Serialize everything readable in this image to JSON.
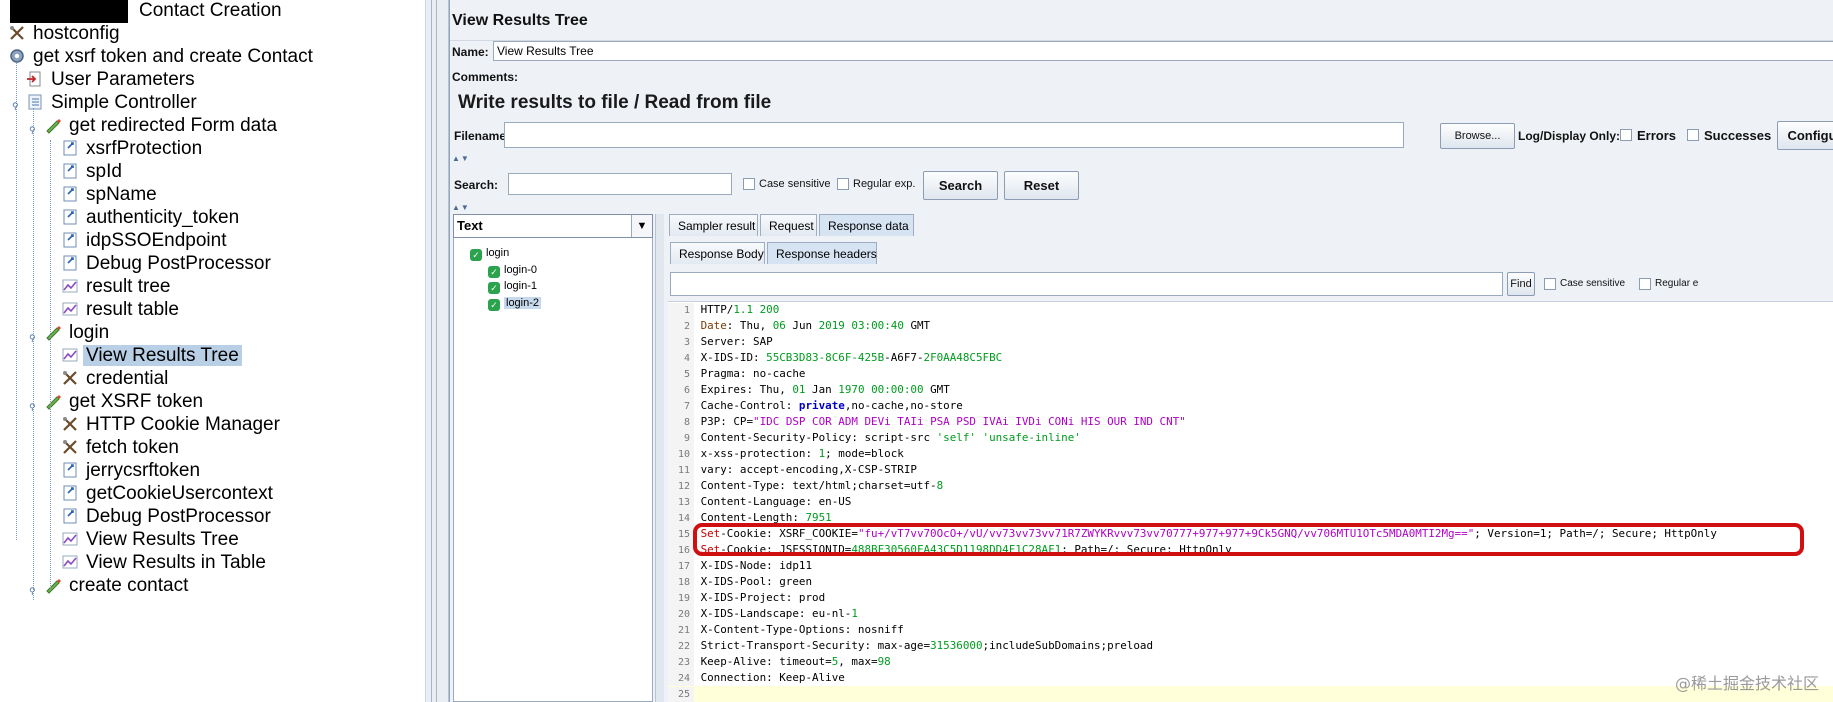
{
  "tree": {
    "items": [
      {
        "label": "Contact Creation",
        "icon": "test-plan-icon",
        "level": 0,
        "redacted_prefix": true
      },
      {
        "label": "hostconfig",
        "icon": "config-element-icon",
        "level": 0
      },
      {
        "label": "get xsrf token and create Contact",
        "icon": "thread-group-gear-icon",
        "level": 0
      },
      {
        "label": "User Parameters",
        "icon": "preprocessor-icon",
        "level": 1
      },
      {
        "label": "Simple Controller",
        "icon": "controller-icon",
        "level": 1
      },
      {
        "label": "get redirected Form data",
        "icon": "sampler-pencil-icon",
        "level": 2
      },
      {
        "label": "xsrfProtection",
        "icon": "extractor-icon",
        "level": 3
      },
      {
        "label": "spId",
        "icon": "extractor-icon",
        "level": 3
      },
      {
        "label": "spName",
        "icon": "extractor-icon",
        "level": 3
      },
      {
        "label": "authenticity_token",
        "icon": "extractor-icon",
        "level": 3
      },
      {
        "label": "idpSSOEndpoint",
        "icon": "extractor-icon",
        "level": 3
      },
      {
        "label": "Debug PostProcessor",
        "icon": "extractor-icon",
        "level": 3
      },
      {
        "label": "result tree",
        "icon": "listener-chart-icon",
        "level": 3
      },
      {
        "label": "result table",
        "icon": "listener-chart-icon",
        "level": 3
      },
      {
        "label": "login",
        "icon": "sampler-pencil-icon",
        "level": 2
      },
      {
        "label": "View Results Tree",
        "icon": "listener-chart-icon",
        "level": 3,
        "selected": true
      },
      {
        "label": "credential",
        "icon": "config-element-icon",
        "level": 3
      },
      {
        "label": "get XSRF token",
        "icon": "sampler-pencil-icon",
        "level": 2
      },
      {
        "label": "HTTP Cookie Manager",
        "icon": "config-element-icon",
        "level": 3
      },
      {
        "label": "fetch token",
        "icon": "config-element-icon",
        "level": 3
      },
      {
        "label": "jerrycsrftoken",
        "icon": "extractor-icon",
        "level": 3
      },
      {
        "label": "getCookieUsercontext",
        "icon": "extractor-icon",
        "level": 3
      },
      {
        "label": "Debug PostProcessor",
        "icon": "extractor-icon",
        "level": 3
      },
      {
        "label": "View Results Tree",
        "icon": "listener-chart-icon",
        "level": 3
      },
      {
        "label": "View Results in Table",
        "icon": "listener-chart-icon",
        "level": 3
      },
      {
        "label": "create contact",
        "icon": "sampler-pencil-icon",
        "level": 2
      }
    ]
  },
  "panel": {
    "title": "View Results Tree",
    "name_label": "Name:",
    "name_value": "View Results Tree",
    "comments_label": "Comments:",
    "section_title": "Write results to file / Read from file",
    "filename_label": "Filename",
    "filename_value": "",
    "browse_label": "Browse...",
    "log_display_label": "Log/Display Only:",
    "errors_label": "Errors",
    "successes_label": "Successes",
    "configure_label": "Configu",
    "search_label": "Search:",
    "search_value": "",
    "case_sensitive_label": "Case sensitive",
    "regex_label": "Regular exp.",
    "search_button": "Search",
    "reset_button": "Reset"
  },
  "results": {
    "renderer": "Text",
    "nodes": [
      {
        "label": "login",
        "level": 0
      },
      {
        "label": "login-0",
        "level": 1
      },
      {
        "label": "login-1",
        "level": 1
      },
      {
        "label": "login-2",
        "level": 1,
        "selected": true
      }
    ],
    "tabs": [
      "Sampler result",
      "Request",
      "Response data"
    ],
    "active_tab": "Response data",
    "subtabs": [
      "Response Body",
      "Response headers"
    ],
    "active_subtab": "Response headers",
    "find_button": "Find",
    "find_case_sensitive": "Case sensitive",
    "find_regex": "Regular e",
    "find_value": ""
  },
  "headers": [
    {
      "n": "1",
      "parts": [
        [
          "cd",
          "HTTP/"
        ],
        [
          "n",
          "1.1"
        ],
        [
          "cd",
          " "
        ],
        [
          "n",
          "200"
        ]
      ]
    },
    {
      "n": "2",
      "parts": [
        [
          "k",
          "Date"
        ],
        [
          "cd",
          ": Thu, "
        ],
        [
          "n",
          "06"
        ],
        [
          "cd",
          " Jun "
        ],
        [
          "n",
          "2019"
        ],
        [
          "cd",
          " "
        ],
        [
          "n",
          "03:00:40"
        ],
        [
          "cd",
          " GMT"
        ]
      ]
    },
    {
      "n": "3",
      "parts": [
        [
          "cd",
          "Server: SAP"
        ]
      ]
    },
    {
      "n": "4",
      "parts": [
        [
          "cd",
          "X-IDS-ID: "
        ],
        [
          "n",
          "55CB3D83-8C6F-425B"
        ],
        [
          "cd",
          "-A6F7-"
        ],
        [
          "n",
          "2F0AA48C5FBC"
        ]
      ]
    },
    {
      "n": "5",
      "parts": [
        [
          "cd",
          "Pragma: no-cache"
        ]
      ]
    },
    {
      "n": "6",
      "parts": [
        [
          "cd",
          "Expires: Thu, "
        ],
        [
          "n",
          "01"
        ],
        [
          "cd",
          " Jan "
        ],
        [
          "n",
          "1970"
        ],
        [
          "cd",
          " "
        ],
        [
          "n",
          "00:00:00"
        ],
        [
          "cd",
          " GMT"
        ]
      ]
    },
    {
      "n": "7",
      "parts": [
        [
          "cd",
          "Cache-Control: "
        ],
        [
          "kw",
          "private"
        ],
        [
          "cd",
          ",no-cache,no-store"
        ]
      ]
    },
    {
      "n": "8",
      "parts": [
        [
          "cd",
          "P3P: CP="
        ],
        [
          "s",
          "\"IDC DSP COR ADM DEVi TAIi PSA PSD IVAi IVDi CONi HIS OUR IND CNT\""
        ]
      ]
    },
    {
      "n": "9",
      "parts": [
        [
          "cd",
          "Content-Security-Policy: script-src "
        ],
        [
          "n",
          "'self' 'unsafe-inline'"
        ]
      ]
    },
    {
      "n": "10",
      "parts": [
        [
          "cd",
          "x-xss-protection: "
        ],
        [
          "n",
          "1"
        ],
        [
          "cd",
          "; mode=block"
        ]
      ]
    },
    {
      "n": "11",
      "parts": [
        [
          "cd",
          "vary: accept-encoding,X-CSP-STRIP"
        ]
      ]
    },
    {
      "n": "12",
      "parts": [
        [
          "cd",
          "Content-Type: text/html;charset=utf-"
        ],
        [
          "n",
          "8"
        ]
      ]
    },
    {
      "n": "13",
      "parts": [
        [
          "cd",
          "Content-Language: en-US"
        ]
      ]
    },
    {
      "n": "14",
      "parts": [
        [
          "cd",
          "Content-Length: "
        ],
        [
          "n",
          "7951"
        ]
      ]
    },
    {
      "n": "15",
      "parts": [
        [
          "t",
          "Set"
        ],
        [
          "cd",
          "-Cookie: XSRF_COOKIE="
        ],
        [
          "s",
          "\"fu+/vT7vv70OcO+/vU/vv73vv73vv71R7ZWYKRvvv73vv70777+977+977+9Ck5GNQ/vv706MTU1OTc5MDA0MTI2Mg==\""
        ],
        [
          "cd",
          "; Version=1; Path=/; Secure; HttpOnly"
        ]
      ]
    },
    {
      "n": "16",
      "parts": [
        [
          "t",
          "Set"
        ],
        [
          "cd",
          "-Cookie: JSESSIONID="
        ],
        [
          "n",
          "488BF30560FA43C5D1198DD4F1C28AF1"
        ],
        [
          "cd",
          "; Path=/; Secure; HttpOnly"
        ]
      ]
    },
    {
      "n": "17",
      "parts": [
        [
          "cd",
          "X-IDS-Node: idp11"
        ]
      ]
    },
    {
      "n": "18",
      "parts": [
        [
          "cd",
          "X-IDS-Pool: green"
        ]
      ]
    },
    {
      "n": "19",
      "parts": [
        [
          "cd",
          "X-IDS-Project: prod"
        ]
      ]
    },
    {
      "n": "20",
      "parts": [
        [
          "cd",
          "X-IDS-Landscape: eu-nl-"
        ],
        [
          "n",
          "1"
        ]
      ]
    },
    {
      "n": "21",
      "parts": [
        [
          "cd",
          "X-Content-Type-Options: nosniff"
        ]
      ]
    },
    {
      "n": "22",
      "parts": [
        [
          "cd",
          "Strict-Transport-Security: max-age="
        ],
        [
          "n",
          "31536000"
        ],
        [
          "cd",
          ";includeSubDomains;preload"
        ]
      ]
    },
    {
      "n": "23",
      "parts": [
        [
          "cd",
          "Keep-Alive: timeout="
        ],
        [
          "n",
          "5"
        ],
        [
          "cd",
          ", max="
        ],
        [
          "n",
          "98"
        ]
      ]
    },
    {
      "n": "24",
      "parts": [
        [
          "cd",
          "Connection: Keep-Alive"
        ]
      ]
    },
    {
      "n": "25",
      "parts": []
    }
  ],
  "annotation": {
    "color": "#d01010",
    "note": "highlighted Set-Cookie lines"
  },
  "watermark": "@稀土掘金技术社区",
  "colors": {
    "selection": "#b8cfe5",
    "accent": "#d6e3f2",
    "highlight": "#d01010"
  }
}
